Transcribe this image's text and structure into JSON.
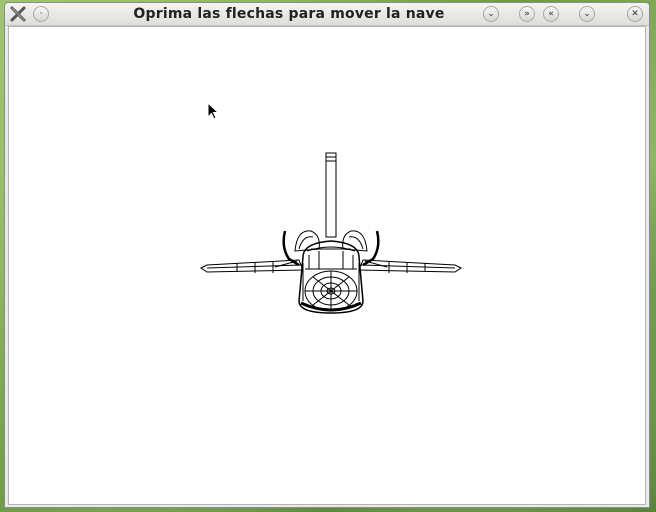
{
  "window": {
    "title": "Oprima las flechas para mover la nave"
  },
  "titlebar": {
    "app_icon": "x-app-icon",
    "buttons": [
      {
        "name": "shade-button",
        "icon": "chevron-down-icon"
      },
      {
        "name": "move-button",
        "icon": "double-chevron-down-icon"
      },
      {
        "name": "raise-button",
        "icon": "double-chevron-up-icon"
      },
      {
        "name": "minimize-button",
        "icon": "chevron-down-icon"
      },
      {
        "name": "close-button",
        "icon": "close-icon"
      }
    ]
  },
  "canvas": {
    "background": "#ffffff",
    "stroke_color": "#000000"
  }
}
